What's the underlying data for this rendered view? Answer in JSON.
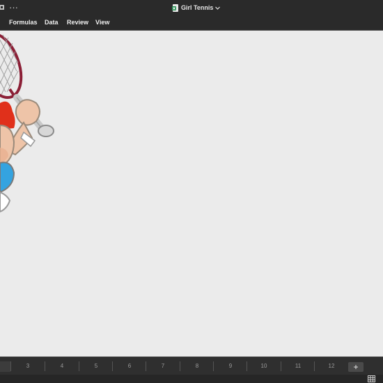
{
  "window": {
    "title": "Girl Tennis",
    "title_icon": "spreadsheet-file-icon",
    "more_icon": "ellipsis-icon",
    "left_icon": "camera-icon"
  },
  "ribbon": {
    "menu": [
      "Formulas",
      "Data",
      "Review",
      "View"
    ]
  },
  "sheet_tabs": [
    "3",
    "4",
    "5",
    "6",
    "7",
    "8",
    "9",
    "10",
    "11",
    "12"
  ],
  "add_sheet_label": "+",
  "status": {
    "icon": "grid-view-icon"
  },
  "colors": {
    "chrome": "#2a2a2a",
    "canvas": "#ebebeb",
    "racket": "#8b1f36",
    "hair": "#e0301b",
    "skin": "#eec4a8",
    "shirt": "#34a3e0"
  }
}
